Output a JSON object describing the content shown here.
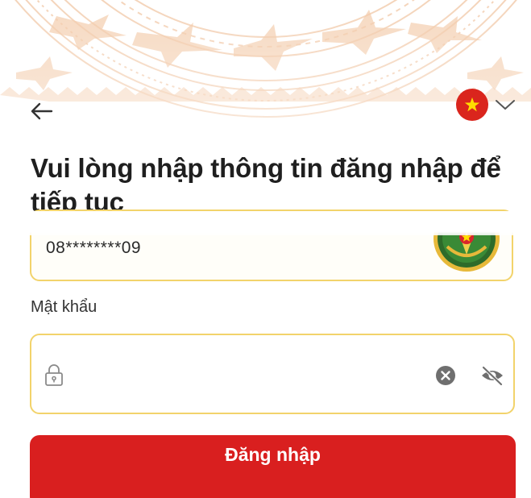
{
  "header": {
    "back_icon": "arrow-left-icon",
    "language_flag": "vietnam-flag-icon",
    "language_dropdown_icon": "chevron-down-icon"
  },
  "title": "Vui lòng nhập thông tin đăng nhập để tiếp tục",
  "phone": {
    "value": "08********09",
    "emblem": "police-emblem"
  },
  "password": {
    "label": "Mật khẩu",
    "value": "",
    "lock_icon": "lock-icon",
    "clear_icon": "clear-icon",
    "visibility_icon": "eye-off-icon"
  },
  "login_button": {
    "label": "Đăng nhập"
  },
  "colors": {
    "primary_red": "#d91f1f",
    "field_border": "#f2d36b",
    "header_pattern": "#f3c9a8"
  }
}
